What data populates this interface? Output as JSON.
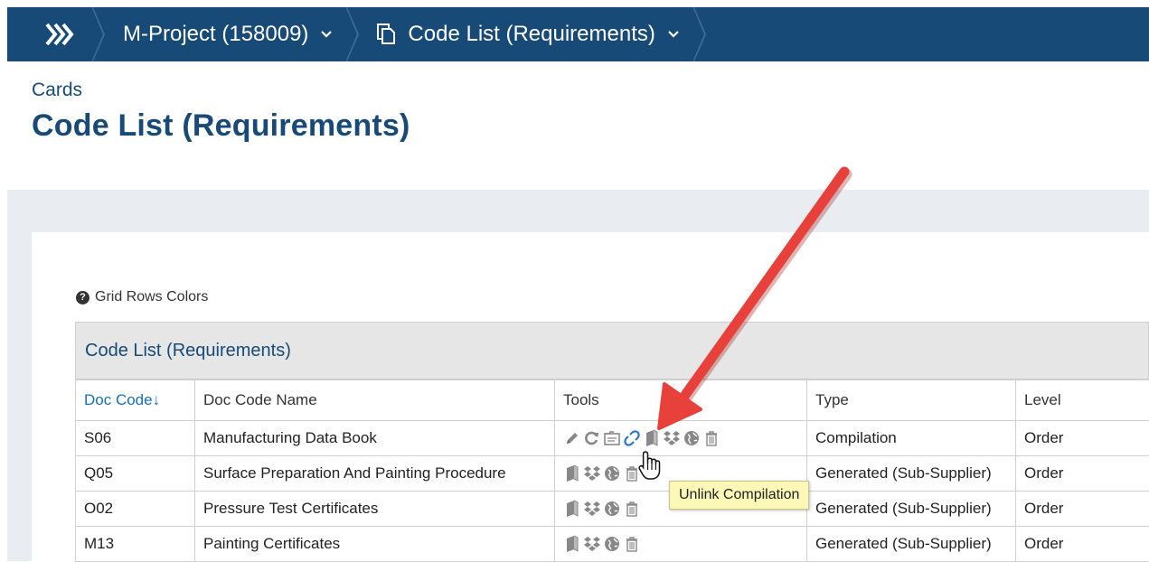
{
  "nav": {
    "project_label": "M-Project (158009)",
    "page_label": "Code List (Requirements)"
  },
  "header": {
    "section": "Cards",
    "title": "Code List (Requirements)"
  },
  "grid_colors_link": "Grid Rows Colors",
  "grid": {
    "caption": "Code List (Requirements)",
    "columns": [
      "Doc Code↓",
      "Doc Code Name",
      "Tools",
      "Type",
      "Level"
    ],
    "rows": [
      {
        "code": "S06",
        "name": "Manufacturing Data Book",
        "type": "Compilation",
        "level": "Order",
        "tools": [
          "pencil-icon",
          "refresh-icon",
          "folder-icon",
          "unlink-icon",
          "book-icon",
          "dropbox-icon",
          "globe-icon",
          "trash-icon"
        ]
      },
      {
        "code": "Q05",
        "name": "Surface Preparation And Painting Procedure",
        "type": "Generated (Sub-Supplier)",
        "level": "Order",
        "tools": [
          "book-icon",
          "dropbox-icon",
          "globe-icon",
          "trash-icon"
        ]
      },
      {
        "code": "O02",
        "name": "Pressure Test Certificates",
        "type": "Generated (Sub-Supplier)",
        "level": "Order",
        "tools": [
          "book-icon",
          "dropbox-icon",
          "globe-icon",
          "trash-icon"
        ]
      },
      {
        "code": "M13",
        "name": "Painting Certificates",
        "type": "Generated (Sub-Supplier)",
        "level": "Order",
        "tools": [
          "book-icon",
          "dropbox-icon",
          "globe-icon",
          "trash-icon"
        ]
      }
    ]
  },
  "tooltip": "Unlink Compilation",
  "colors": {
    "nav_bg": "#174a76",
    "title": "#174a76",
    "link": "#1a6fb5",
    "arrow": "#e8403b",
    "tooltip_bg": "#fcf9b8"
  }
}
